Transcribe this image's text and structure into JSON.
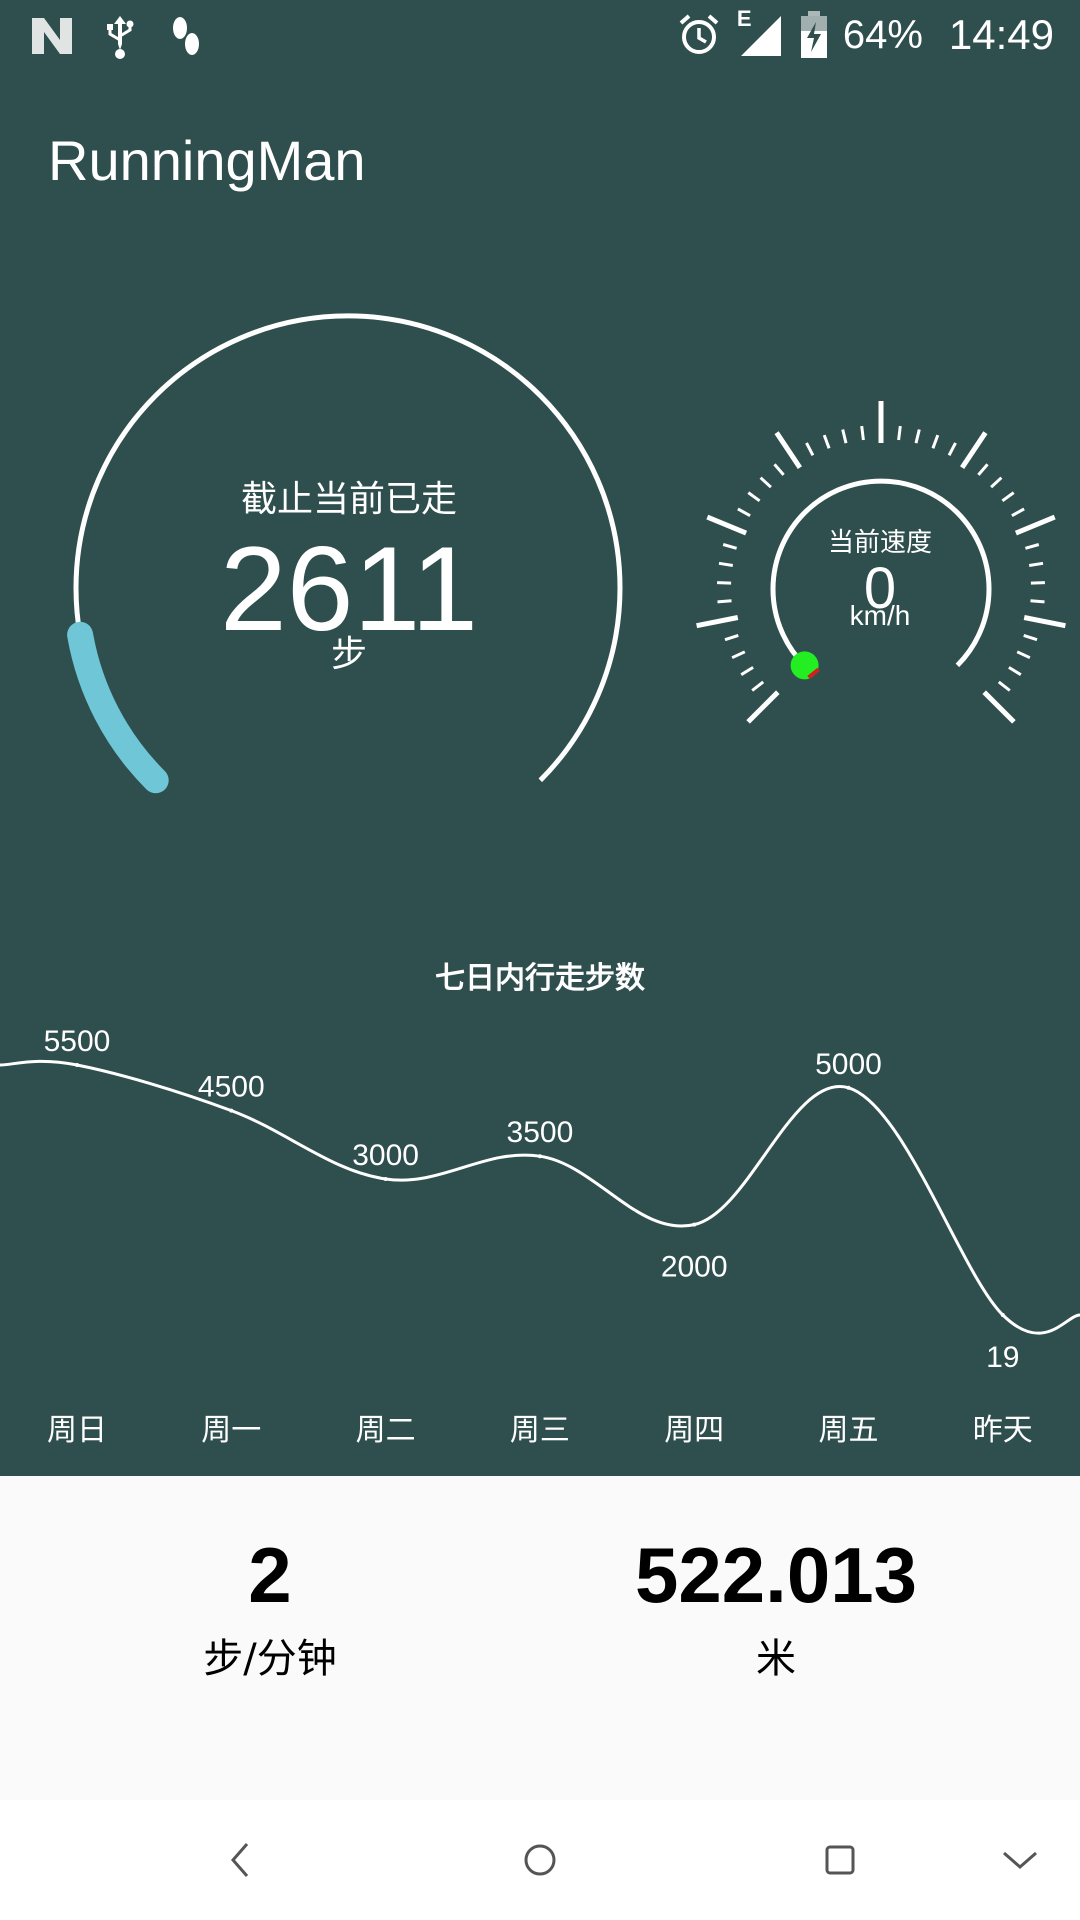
{
  "status_bar": {
    "battery_percent": "64%",
    "time": "14:49",
    "network_type": "E",
    "icons": [
      "n-logo-icon",
      "usb-icon",
      "footprints-icon",
      "alarm-icon",
      "signal-icon",
      "battery-charging-icon"
    ]
  },
  "app_bar": {
    "title": "RunningMan"
  },
  "steps_gauge": {
    "caption": "截止当前已走",
    "value": "2611",
    "unit": "步",
    "progress_fraction": 0.13,
    "accent_color": "#6ec6d6"
  },
  "speed_gauge": {
    "caption": "当前速度",
    "value": "0",
    "unit": "km/h"
  },
  "weekly_chart": {
    "title": "七日内行走步数"
  },
  "chart_data": {
    "type": "line",
    "title": "七日内行走步数",
    "categories": [
      "周日",
      "周一",
      "周二",
      "周三",
      "周四",
      "周五",
      "昨天"
    ],
    "series": [
      {
        "values": [
          5500,
          4500,
          3000,
          3500,
          2000,
          5000,
          19
        ]
      }
    ],
    "value_labels": [
      "5500",
      "4500",
      "3000",
      "3500",
      "2000",
      "5000",
      "19"
    ],
    "ylim": [
      0,
      7000
    ],
    "grid": false,
    "curve": "smooth",
    "color": "#ffffff"
  },
  "summary": {
    "cadence_value": "2",
    "cadence_unit": "步/分钟",
    "distance_value": "522.013",
    "distance_unit": "米"
  },
  "nav_bar": {
    "icons": [
      "back-icon",
      "home-icon",
      "recents-icon",
      "collapse-icon"
    ]
  }
}
